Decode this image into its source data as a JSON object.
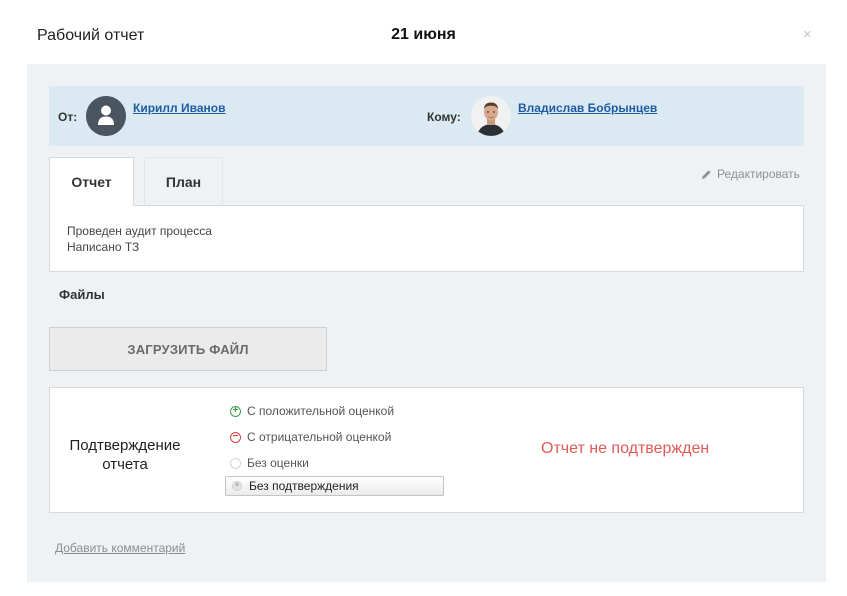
{
  "dialog": {
    "title": "Рабочий отчет",
    "date": "21 июня",
    "close_symbol": "×"
  },
  "people": {
    "from_label": "От:",
    "from_name": "Кирилл Иванов",
    "from_avatar_icon": "user-placeholder-icon",
    "to_label": "Кому:",
    "to_name": "Владислав Бобрынцев",
    "to_avatar_icon": "user-photo"
  },
  "tabs": [
    {
      "label": "Отчет",
      "active": true
    },
    {
      "label": "План",
      "active": false
    }
  ],
  "edit_label": "Редактировать",
  "report_lines": [
    "Проведен аудит процесса",
    "Написано ТЗ"
  ],
  "files": {
    "label": "Файлы",
    "upload_label": "ЗАГРУЗИТЬ ФАЙЛ"
  },
  "confirmation": {
    "label": "Подтверждение отчета",
    "options": [
      {
        "label": "С положительной оценкой",
        "icon": "plus-circle-icon"
      },
      {
        "label": "С отрицательной оценкой",
        "icon": "minus-circle-icon"
      },
      {
        "label": "Без оценки",
        "icon": "empty-circle-icon"
      }
    ],
    "no_confirm_label": "Без подтверждения",
    "status_text": "Отчет не подтвержден"
  },
  "add_comment": "Добавить комментарий",
  "colors": {
    "panel_bg": "#eef2f4",
    "people_bg": "#dbeaf2",
    "link": "#1f5ba3",
    "positive": "#3aa04a",
    "negative": "#d94040",
    "status": "#e05a55"
  }
}
